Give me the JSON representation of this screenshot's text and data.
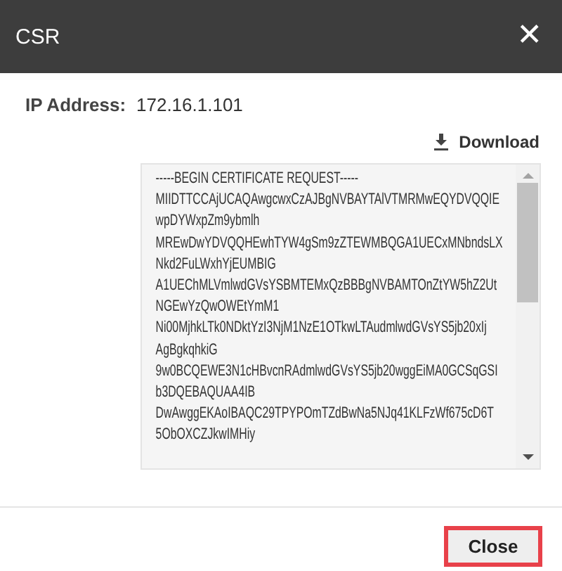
{
  "dialog": {
    "title": "CSR",
    "close_icon": "✕"
  },
  "ip": {
    "label": "IP Address:",
    "value": "172.16.1.101"
  },
  "download": {
    "label": "Download"
  },
  "csr_lines": [
    "-----BEGIN CERTIFICATE REQUEST-----",
    "MIIDTTCCAjUCAQAwgcwxCzAJBgNVBAYTAlVTMRMwEQYDVQQIE",
    "wpDYWxpZm9ybmlh",
    "MREwDwYDVQQHEwhTYW4gSm9zZTEWMBQGA1UECxMNbndsLX",
    "Nkd2FuLWxhYjEUMBIG",
    "A1UEChMLVmlwdGVsYSBMTEMxQzBBBgNVBAMTOnZtYW5hZ2Ut",
    "NGEwYzQwOWEtYmM1",
    "Ni00MjhkLTk0NDktYzI3NjM1NzE1OTkwLTAudmlwdGVsYS5jb20xIj",
    "AgBgkqhkiG",
    "9w0BCQEWE3N1cHBvcnRAdmlwdGVsYS5jb20wggEiMA0GCSqGSI",
    "b3DQEBAQUAA4IB",
    "DwAwggEKAoIBAQC29TPYPOmTZdBwNa5NJq41KLFzWf675cD6T",
    "5ObOXCZJkwIMHiy"
  ],
  "footer": {
    "close_button": "Close",
    "highlighted": true
  }
}
